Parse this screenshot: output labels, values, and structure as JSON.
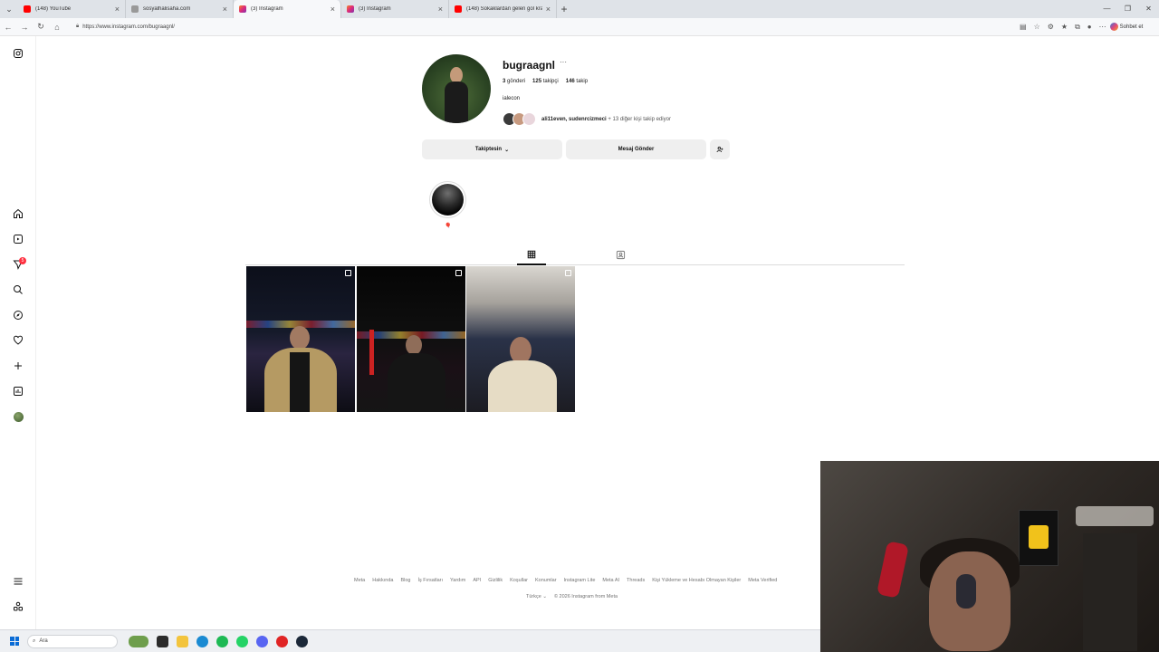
{
  "browser": {
    "tabs": [
      {
        "title": "(148) YouTube",
        "color": "#ff0000"
      },
      {
        "title": "sosyalhalisaha.com",
        "color": "#888888"
      },
      {
        "title": "(3) Instagram",
        "color": "#e1306c",
        "active": true
      },
      {
        "title": "(3) Instagram",
        "color": "#e1306c"
      },
      {
        "title": "(148) Sokaklardan gelen gol kralı...",
        "color": "#ff0000"
      }
    ],
    "url": "https://www.instagram.com/bugraagnl/",
    "copilot_label": "Sohbet et"
  },
  "profile": {
    "username": "bugraagnl",
    "posts_count": "3",
    "posts_label": "gönderi",
    "followers_count": "125",
    "followers_label": "takipçi",
    "following_count": "146",
    "following_label": "takip",
    "bio": "ialecon",
    "followed_by_names": "ali11even, sudenrcizmeci",
    "followed_by_more": "+ 13 diğer kişi takip ediyor",
    "follow_button": "Takiptesin",
    "message_button": "Mesaj Gönder",
    "highlight_label": "🎈"
  },
  "footer": {
    "links": [
      "Meta",
      "Hakkında",
      "Blog",
      "İş Fırsatları",
      "Yardım",
      "API",
      "Gizlilik",
      "Koşullar",
      "Konumlar",
      "Instagram Lite",
      "Meta AI",
      "Threads",
      "Kişi Yükleme ve Hesabı Olmayan Kişiler",
      "Meta Verified"
    ],
    "language": "Türkçe",
    "copyright": "© 2026 Instagram from Meta"
  },
  "taskbar": {
    "search_placeholder": "Ara"
  },
  "rail": {
    "notification_count": "5"
  }
}
